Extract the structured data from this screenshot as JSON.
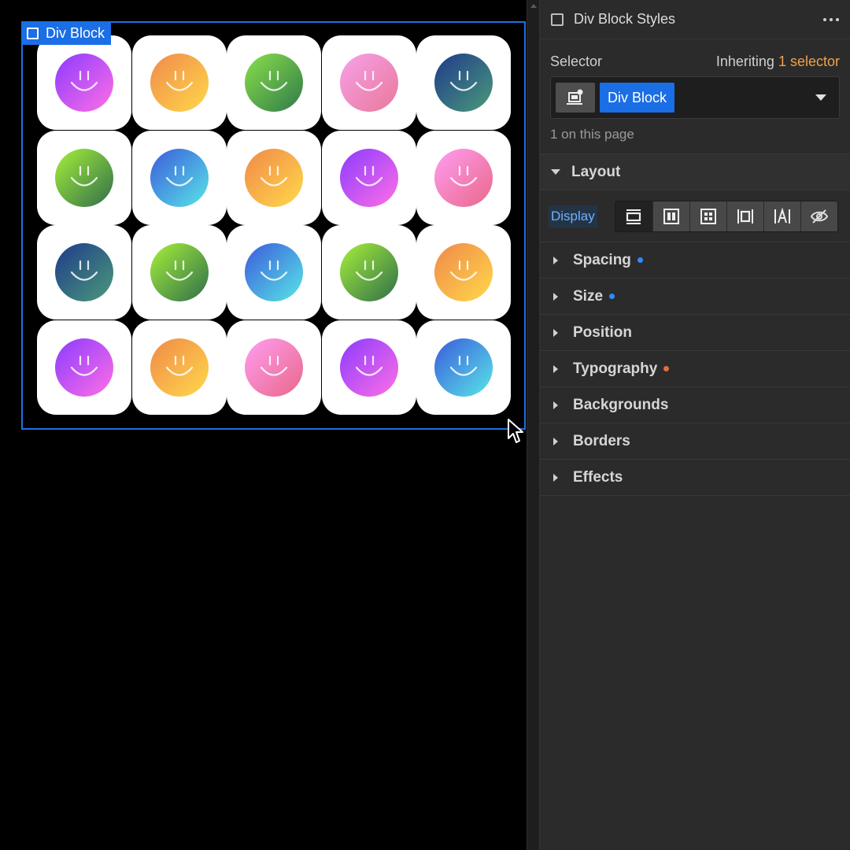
{
  "canvas": {
    "element_tag_label": "Div Block",
    "faces": [
      [
        "#8b3bff",
        "#ff6fe6"
      ],
      [
        "#f08a4b",
        "#ffd84a"
      ],
      [
        "#8ae04a",
        "#2f7a4a"
      ],
      [
        "#f7a1e8",
        "#e9789a"
      ],
      [
        "#1f3a8a",
        "#4a9a7a"
      ],
      [
        "#a6f03a",
        "#2f6e4a"
      ],
      [
        "#3b5bdc",
        "#58e6e6"
      ],
      [
        "#f0894a",
        "#ffd94a"
      ],
      [
        "#8b3bff",
        "#ff6fe6"
      ],
      [
        "#ff9ef0",
        "#e9678a"
      ],
      [
        "#1f3a8a",
        "#4a9a7a"
      ],
      [
        "#a6f03a",
        "#2f6e4a"
      ],
      [
        "#3b5bdc",
        "#58e6e6"
      ],
      [
        "#a6f03a",
        "#2f6e4a"
      ],
      [
        "#f0894a",
        "#ffd94a"
      ],
      [
        "#8b3bff",
        "#ff6fe6"
      ],
      [
        "#f0894a",
        "#ffd94a"
      ],
      [
        "#ff9ef0",
        "#e9678a"
      ],
      [
        "#8b3bff",
        "#ff6fe6"
      ],
      [
        "#3b5bdc",
        "#58e6e6"
      ]
    ]
  },
  "panel": {
    "title": "Div Block Styles",
    "selector": {
      "label": "Selector",
      "inheriting_prefix": "Inheriting",
      "inheriting_link": "1 selector",
      "class_chip": "Div Block",
      "usage_note": "1 on this page"
    },
    "sections": {
      "layout": "Layout",
      "display_label": "Display",
      "spacing": "Spacing",
      "size": "Size",
      "position": "Position",
      "typography": "Typography",
      "backgrounds": "Backgrounds",
      "borders": "Borders",
      "effects": "Effects"
    },
    "display_options": [
      "block",
      "flex",
      "grid",
      "inline-block",
      "inline",
      "none"
    ],
    "colors": {
      "accent_blue": "#1a6ee6",
      "inherit_orange": "#f2a14b",
      "dot_blue": "#2f8bff",
      "dot_orange": "#e2703a"
    }
  }
}
